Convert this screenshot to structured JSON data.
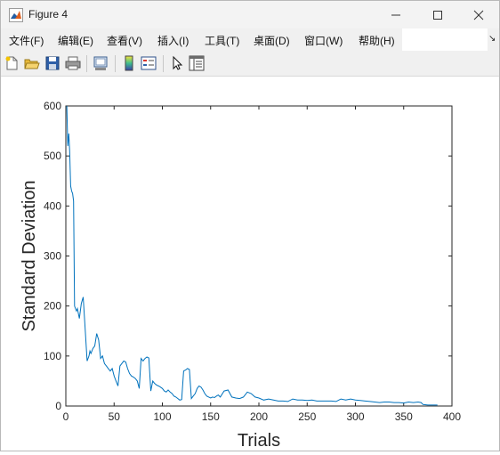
{
  "window": {
    "title": "Figure 4"
  },
  "menu": {
    "items": [
      "文件(F)",
      "编辑(E)",
      "查看(V)",
      "插入(I)",
      "工具(T)",
      "桌面(D)",
      "窗口(W)",
      "帮助(H)"
    ],
    "overflow_icon": "resize-arrow-icon"
  },
  "toolbar": {
    "icons": [
      "new-figure-icon",
      "open-file-icon",
      "save-icon",
      "print-icon",
      "print-preview-icon",
      "colorbar-icon",
      "legend-icon",
      "pointer-icon",
      "property-inspector-icon"
    ]
  },
  "chart_data": {
    "type": "line",
    "xlabel": "Trials",
    "ylabel": "Standard Deviation",
    "xlim": [
      0,
      400
    ],
    "ylim": [
      0,
      600
    ],
    "xticks": [
      "0",
      "50",
      "100",
      "150",
      "200",
      "250",
      "300",
      "350",
      "400"
    ],
    "yticks": [
      "0",
      "100",
      "200",
      "300",
      "400",
      "500",
      "600"
    ],
    "grid": false,
    "line_color": "#0072BD",
    "series": [
      {
        "x": [
          1,
          2,
          3,
          4,
          5,
          6,
          7,
          8,
          9,
          10,
          11,
          12,
          14,
          16,
          18,
          20,
          22,
          24,
          25,
          26,
          28,
          30,
          32,
          34,
          36,
          38,
          40,
          42,
          44,
          46,
          48,
          50,
          52,
          54,
          56,
          58,
          60,
          62,
          64,
          66,
          68,
          70,
          72,
          74,
          76,
          78,
          80,
          82,
          84,
          86,
          88,
          90,
          92,
          94,
          96,
          98,
          100,
          102,
          104,
          106,
          108,
          110,
          112,
          114,
          116,
          118,
          120,
          122,
          124,
          126,
          128,
          130,
          132,
          134,
          136,
          138,
          140,
          142,
          144,
          146,
          148,
          150,
          152,
          154,
          156,
          158,
          160,
          164,
          168,
          172,
          176,
          180,
          184,
          188,
          192,
          196,
          200,
          205,
          210,
          215,
          220,
          225,
          230,
          235,
          240,
          245,
          250,
          255,
          260,
          265,
          270,
          275,
          280,
          285,
          290,
          295,
          300,
          305,
          310,
          315,
          320,
          325,
          330,
          335,
          340,
          345,
          350,
          355,
          360,
          365,
          368,
          370,
          375,
          380,
          385
        ],
        "y": [
          600,
          520,
          545,
          510,
          440,
          430,
          425,
          410,
          200,
          195,
          190,
          195,
          175,
          205,
          218,
          155,
          90,
          100,
          110,
          105,
          115,
          120,
          145,
          132,
          95,
          100,
          85,
          80,
          75,
          70,
          75,
          60,
          50,
          40,
          80,
          85,
          90,
          88,
          75,
          65,
          60,
          58,
          55,
          50,
          35,
          95,
          90,
          95,
          98,
          96,
          30,
          50,
          45,
          42,
          40,
          38,
          35,
          30,
          28,
          32,
          28,
          25,
          20,
          18,
          15,
          12,
          13,
          70,
          72,
          75,
          73,
          15,
          20,
          25,
          35,
          40,
          38,
          32,
          25,
          20,
          18,
          16,
          18,
          17,
          20,
          22,
          18,
          30,
          32,
          18,
          16,
          15,
          18,
          28,
          25,
          18,
          16,
          12,
          14,
          12,
          10,
          10,
          9,
          14,
          12,
          12,
          11,
          12,
          10,
          10,
          10,
          10,
          9,
          14,
          12,
          14,
          12,
          11,
          10,
          9,
          8,
          7,
          8,
          8,
          7,
          7,
          6,
          8,
          7,
          8,
          7,
          3,
          2,
          2,
          2
        ],
        "color": "#0072BD"
      }
    ]
  }
}
